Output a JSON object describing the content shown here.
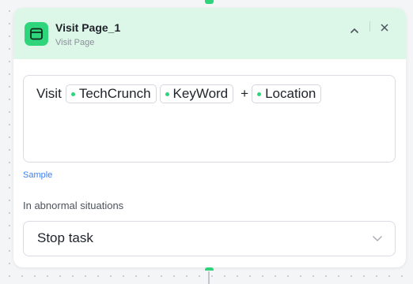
{
  "node": {
    "title": "Visit Page_1",
    "subtitle": "Visit Page",
    "accent_color": "#2fd57b",
    "header_bg": "#dcf7e8",
    "icon": "browser-window-icon"
  },
  "url_expression": {
    "prefix": "Visit",
    "tokens": [
      {
        "label": "TechCrunch"
      },
      {
        "label": "KeyWord"
      },
      {
        "label": "Location"
      }
    ],
    "operator": "+"
  },
  "sample_link": "Sample",
  "abnormal": {
    "label": "In abnormal situations",
    "selected": "Stop task"
  },
  "link_color": "#3c7ef0"
}
